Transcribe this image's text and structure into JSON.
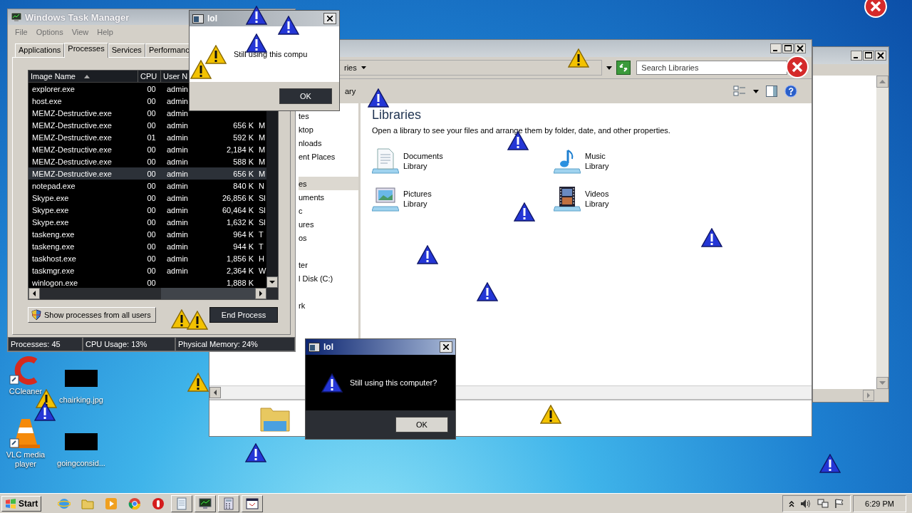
{
  "task_manager": {
    "title": "Windows Task Manager",
    "menu": [
      "File",
      "Options",
      "View",
      "Help"
    ],
    "tabs": [
      {
        "label": "Applications",
        "selected": false
      },
      {
        "label": "Processes",
        "selected": true
      },
      {
        "label": "Services",
        "selected": false
      },
      {
        "label": "Performanc",
        "selected": false
      }
    ],
    "columns": [
      "Image Name",
      "CPU",
      "User N"
    ],
    "rows": [
      {
        "name": "explorer.exe",
        "cpu": "00",
        "user": "admin",
        "selected": false
      },
      {
        "name": "host.exe",
        "cpu": "00",
        "user": "admin",
        "selected": false
      },
      {
        "name": "MEMZ-Destructive.exe",
        "cpu": "00",
        "user": "admin",
        "selected": false
      },
      {
        "name": "MEMZ-Destructive.exe",
        "cpu": "00",
        "user": "admin",
        "memory": "656 K",
        "description": "M",
        "selected": false
      },
      {
        "name": "MEMZ-Destructive.exe",
        "cpu": "01",
        "user": "admin",
        "memory": "592 K",
        "description": "M",
        "selected": false
      },
      {
        "name": "MEMZ-Destructive.exe",
        "cpu": "00",
        "user": "admin",
        "memory": "2,184 K",
        "description": "M",
        "selected": false
      },
      {
        "name": "MEMZ-Destructive.exe",
        "cpu": "00",
        "user": "admin",
        "memory": "588 K",
        "description": "M",
        "selected": false
      },
      {
        "name": "MEMZ-Destructive.exe",
        "cpu": "00",
        "user": "admin",
        "memory": "656 K",
        "description": "M",
        "selected": true
      },
      {
        "name": "notepad.exe",
        "cpu": "00",
        "user": "admin",
        "memory": "840 K",
        "description": "N",
        "selected": false
      },
      {
        "name": "Skype.exe",
        "cpu": "00",
        "user": "admin",
        "memory": "26,856 K",
        "description": "Sl",
        "selected": false
      },
      {
        "name": "Skype.exe",
        "cpu": "00",
        "user": "admin",
        "memory": "60,464 K",
        "description": "Sl",
        "selected": false
      },
      {
        "name": "Skype.exe",
        "cpu": "00",
        "user": "admin",
        "memory": "1,632 K",
        "description": "Sl",
        "selected": false
      },
      {
        "name": "taskeng.exe",
        "cpu": "00",
        "user": "admin",
        "memory": "964 K",
        "description": "T",
        "selected": false
      },
      {
        "name": "taskeng.exe",
        "cpu": "00",
        "user": "admin",
        "memory": "944 K",
        "description": "T",
        "selected": false
      },
      {
        "name": "taskhost.exe",
        "cpu": "00",
        "user": "admin",
        "memory": "1,856 K",
        "description": "H",
        "selected": false
      },
      {
        "name": "taskmgr.exe",
        "cpu": "00",
        "user": "admin",
        "memory": "2,364 K",
        "description": "W",
        "selected": false
      },
      {
        "name": "winlogon.exe",
        "cpu": "00",
        "memory": "1,888 K",
        "selected": false
      }
    ],
    "show_all_button": "Show processes from all users",
    "end_button": "End Process",
    "status": [
      "Processes: 45",
      "CPU Usage: 13%",
      "Physical Memory: 24%"
    ]
  },
  "explorer": {
    "address": "ries",
    "toolbar_label": "ary",
    "search": {
      "placeholder": "Search Libraries"
    },
    "nav_groups": [
      {
        "items": [
          {
            "label": "tes",
            "selected": false
          },
          {
            "label": "ktop",
            "selected": false
          },
          {
            "label": "nloads",
            "selected": false
          },
          {
            "label": "ent Places",
            "selected": false
          }
        ]
      },
      {
        "items": [
          {
            "label": "es",
            "selected": true
          },
          {
            "label": "uments",
            "selected": false
          },
          {
            "label": "c",
            "selected": false
          },
          {
            "label": "ures",
            "selected": false
          },
          {
            "label": "os",
            "selected": false
          }
        ]
      },
      {
        "items": [
          {
            "label": "ter",
            "selected": false
          },
          {
            "label": "l Disk (C:)",
            "selected": false
          }
        ]
      },
      {
        "items": [
          {
            "label": "rk",
            "selected": false
          }
        ]
      }
    ],
    "heading": "Libraries",
    "description": "Open a library to see your files and arrange them by folder, date, and other properties.",
    "libraries": [
      {
        "kind": "documents",
        "name": "Documents",
        "sub": "Library"
      },
      {
        "kind": "music",
        "name": "Music",
        "sub": "Library"
      },
      {
        "kind": "pictures",
        "name": "Pictures",
        "sub": "Library"
      },
      {
        "kind": "videos",
        "name": "Videos",
        "sub": "Library"
      }
    ]
  },
  "dialogs": [
    {
      "kind": "light",
      "title": "lol",
      "message": "Still using this compu",
      "button": "OK"
    },
    {
      "kind": "dark",
      "title": "lol",
      "message": "Still using this computer?",
      "button": "OK"
    }
  ],
  "desktop_icons": [
    {
      "kind": "ccleaner",
      "label": "CCleaner"
    },
    {
      "kind": "image",
      "label": "chairking.jpg"
    },
    {
      "kind": "vlc",
      "label": "VLC media player"
    },
    {
      "kind": "image",
      "label": "goingconsid..."
    }
  ],
  "taskbar": {
    "start": "Start",
    "apps": [
      {
        "kind": "ie",
        "open": false
      },
      {
        "kind": "folder",
        "open": false
      },
      {
        "kind": "media",
        "open": false
      },
      {
        "kind": "chrome",
        "open": false
      },
      {
        "kind": "opera",
        "open": false
      },
      {
        "kind": "notepad",
        "open": true
      },
      {
        "kind": "taskmgr",
        "open": true
      },
      {
        "kind": "calc",
        "open": true
      },
      {
        "kind": "window",
        "open": true
      }
    ],
    "clock": "6:29 PM"
  }
}
